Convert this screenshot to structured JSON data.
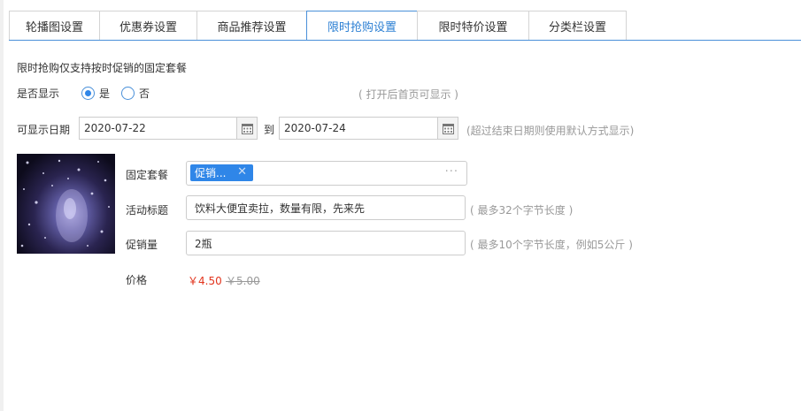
{
  "tabs": [
    {
      "label": "轮播图设置",
      "active": false
    },
    {
      "label": "优惠券设置",
      "active": false
    },
    {
      "label": "商品推荐设置",
      "active": false
    },
    {
      "label": "限时抢购设置",
      "active": true
    },
    {
      "label": "限时特价设置",
      "active": false
    },
    {
      "label": "分类栏设置",
      "active": false
    }
  ],
  "intro": "限时抢购仅支持按时促销的固定套餐",
  "display": {
    "label": "是否显示",
    "yes_label": "是",
    "no_label": "否",
    "selected": "是",
    "hint": "( 打开后首页可显示 )"
  },
  "date_range": {
    "label": "可显示日期",
    "start": "2020-07-22",
    "separator": "到",
    "end": "2020-07-24",
    "hint": "(超过结束日期则使用默认方式显示)"
  },
  "package": {
    "label": "固定套餐",
    "tag": "促销...",
    "tag_remove": "✕",
    "more": "···"
  },
  "title_field": {
    "label": "活动标题",
    "value": "饮料大便宜卖拉，数量有限，先来先",
    "hint": "( 最多32个字节长度 )"
  },
  "quantity_field": {
    "label": "促销量",
    "value": "2瓶",
    "hint": "( 最多10个字节长度，例如5公斤 )"
  },
  "price": {
    "label": "价格",
    "current": "￥4.50",
    "original": "￥5.00"
  },
  "colors": {
    "accent": "#2f86e8",
    "price_red": "#e2341d",
    "tab_border": "#4a90d9"
  }
}
